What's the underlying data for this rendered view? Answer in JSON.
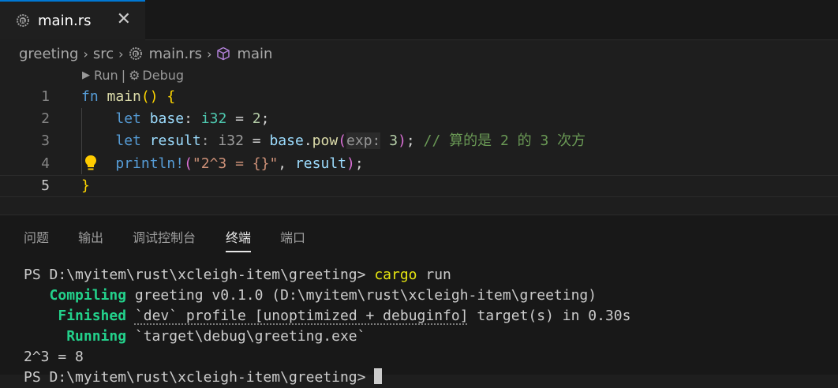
{
  "tab": {
    "label": "main.rs",
    "close": "✕"
  },
  "breadcrumb": {
    "items": [
      "greeting",
      "src",
      "main.rs",
      "main"
    ]
  },
  "codelens": {
    "run": "Run",
    "separator": "|",
    "debug": "Debug"
  },
  "editor": {
    "line_numbers": [
      "1",
      "2",
      "3",
      "4",
      "5"
    ],
    "lines": {
      "l1": [
        "fn",
        "main",
        "()",
        " ",
        "{"
      ],
      "l2": [
        "let",
        "base",
        ": ",
        "i32",
        " = ",
        "2",
        ";"
      ],
      "l3": [
        "let",
        "result",
        ": ",
        "i32",
        " = ",
        "base",
        ".",
        "pow",
        "(",
        "exp:",
        " ",
        "3",
        ")",
        "; ",
        "// 算的是 2 的 3 次方"
      ],
      "l4": [
        "println!",
        "(",
        "\"2^3 = {}\"",
        ", ",
        "result",
        ")",
        ";"
      ],
      "l5": [
        "}"
      ]
    }
  },
  "panel": {
    "tabs": [
      "问题",
      "输出",
      "调试控制台",
      "终端",
      "端口"
    ],
    "active_tab": "终端",
    "terminal": {
      "line1_prompt": "PS D:\\myitem\\rust\\xcleigh-item\\greeting> ",
      "line1_cmd": "cargo",
      "line1_arg": " run",
      "line2_status": "Compiling",
      "line2_text": " greeting v0.1.0 (D:\\myitem\\rust\\xcleigh-item\\greeting)",
      "line3_status": "Finished",
      "line3_dotted": "`dev` profile [unoptimized + debuginfo]",
      "line3_text": " target(s) in 0.30s",
      "line4_status": "Running",
      "line4_text": " `target\\debug\\greeting.exe`",
      "line5": "2^3 = 8",
      "line6_prompt": "PS D:\\myitem\\rust\\xcleigh-item\\greeting> "
    }
  },
  "colors": {
    "accent": "#0078d4",
    "editor_bg": "#1e1e1e",
    "panel_bg": "#181818",
    "terminal_green": "#23d18b",
    "terminal_yellow": "#e5e510"
  }
}
